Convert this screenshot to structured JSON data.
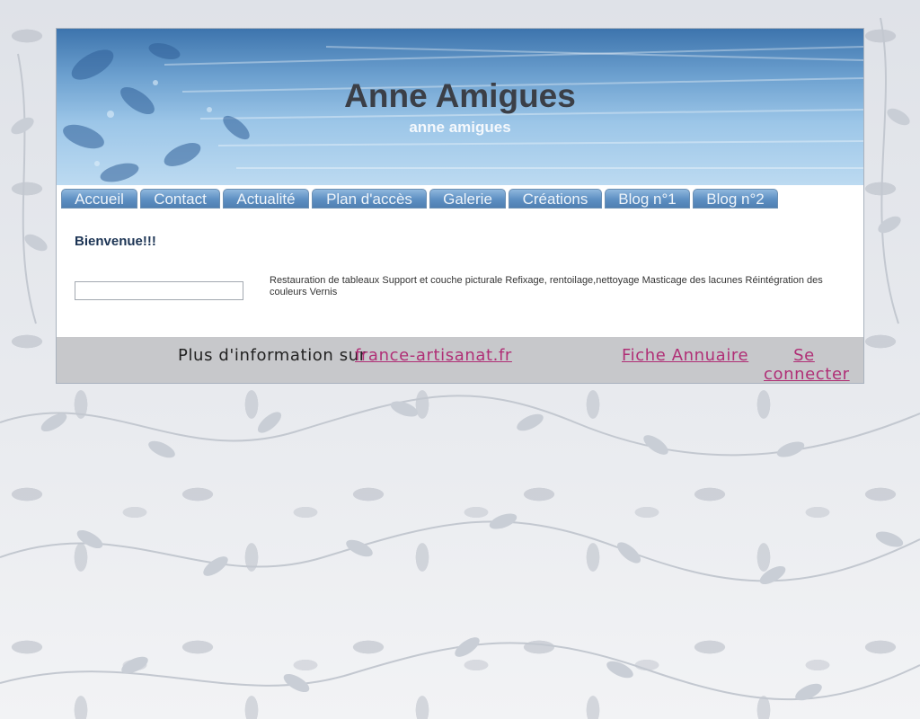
{
  "header": {
    "title": "Anne Amigues",
    "subtitle": "anne amigues"
  },
  "nav": {
    "items": [
      {
        "label": "Accueil"
      },
      {
        "label": "Contact"
      },
      {
        "label": "Actualité"
      },
      {
        "label": "Plan d'accès"
      },
      {
        "label": "Galerie"
      },
      {
        "label": "Créations"
      },
      {
        "label": "Blog n°1"
      },
      {
        "label": "Blog n°2"
      }
    ]
  },
  "content": {
    "heading": "Bienvenue!!!",
    "field_value": "",
    "description": "Restauration de tableaux Support et couche picturale Refixage, rentoilage,nettoyage Masticage des lacunes Réintégration des couleurs Vernis"
  },
  "footer": {
    "more_text": "Plus d'information sur",
    "site_link": "france-artisanat.fr",
    "fiche_link": "Fiche Annuaire",
    "login_link": "Se connecter"
  },
  "colors": {
    "link": "#b02f76",
    "heading": "#1d3555",
    "footer_bg": "#c7c8cb"
  }
}
